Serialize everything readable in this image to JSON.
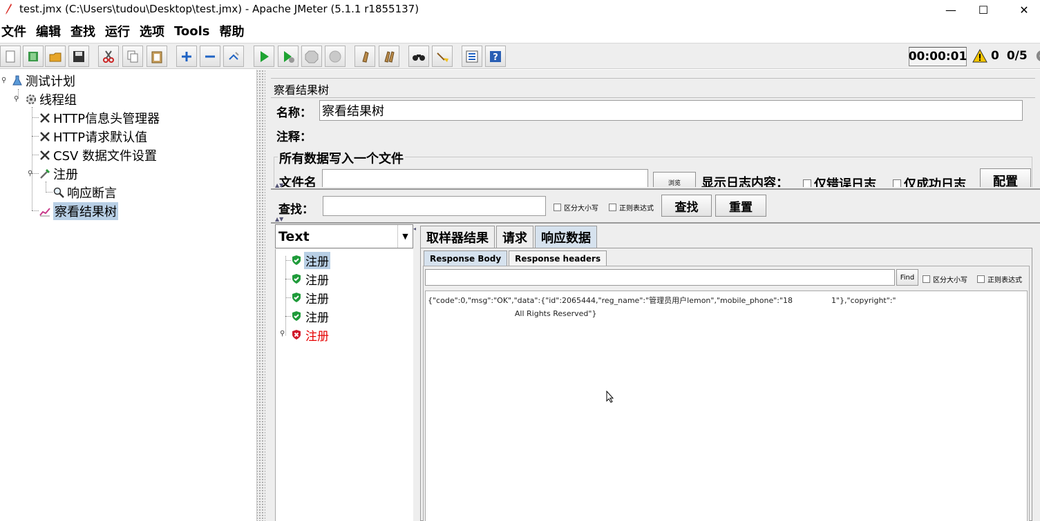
{
  "window": {
    "title": "test.jmx (C:\\Users\\tudou\\Desktop\\test.jmx) - Apache JMeter (5.1.1 r1855137)",
    "minimize_glyph": "—",
    "maximize_glyph": "☐",
    "close_glyph": "✕"
  },
  "menu": [
    "文件",
    "编辑",
    "查找",
    "运行",
    "选项",
    "Tools",
    "帮助"
  ],
  "toolbar": {
    "timer": "00:00:01",
    "warning_count": "0",
    "threads": "0/5"
  },
  "tree": {
    "nodes": [
      {
        "label": "测试计划"
      },
      {
        "label": "线程组"
      },
      {
        "label": "HTTP信息头管理器"
      },
      {
        "label": "HTTP请求默认值"
      },
      {
        "label": "CSV 数据文件设置"
      },
      {
        "label": "注册"
      },
      {
        "label": "响应断言"
      },
      {
        "label": "察看结果树"
      }
    ]
  },
  "panel": {
    "title": "察看结果树",
    "name_label": "名称：",
    "name_value": "察看结果树",
    "comment_label": "注释：",
    "fieldset_title": "所有数据写入一个文件",
    "filename_label": "文件名",
    "browse_label": "浏览",
    "log_label": "显示日志内容：",
    "errors_only": "仅错误日志",
    "success_only": "仅成功日志",
    "config_button": "配置"
  },
  "search": {
    "label": "查找：",
    "case_sensitive": "区分大小写",
    "regex": "正则表达式",
    "find_button": "查找",
    "reset_button": "重置"
  },
  "renderer": {
    "selected": "Text"
  },
  "results": [
    {
      "label": "注册",
      "status": "ok"
    },
    {
      "label": "注册",
      "status": "ok"
    },
    {
      "label": "注册",
      "status": "ok"
    },
    {
      "label": "注册",
      "status": "ok"
    },
    {
      "label": "注册",
      "status": "error"
    }
  ],
  "tabs": [
    "取样器结果",
    "请求",
    "响应数据"
  ],
  "response": {
    "subtabs": [
      "Response Body",
      "Response headers"
    ],
    "find_button": "Find",
    "case_sensitive": "区分大小写",
    "regex": "正则表达式",
    "body_line1": "{\"code\":0,\"msg\":\"OK\",\"data\":{\"id\":2065444,\"reg_name\":\"管理员用户lemon\",\"mobile_phone\":\"18                1\"},\"copyright\":\"",
    "body_line2": "                                    All Rights Reserved\"}"
  },
  "colors": {
    "selection": "#b8cfe5",
    "error_text": "#e60000",
    "success_icon": "#1f9b3a",
    "error_icon": "#d0192b"
  }
}
